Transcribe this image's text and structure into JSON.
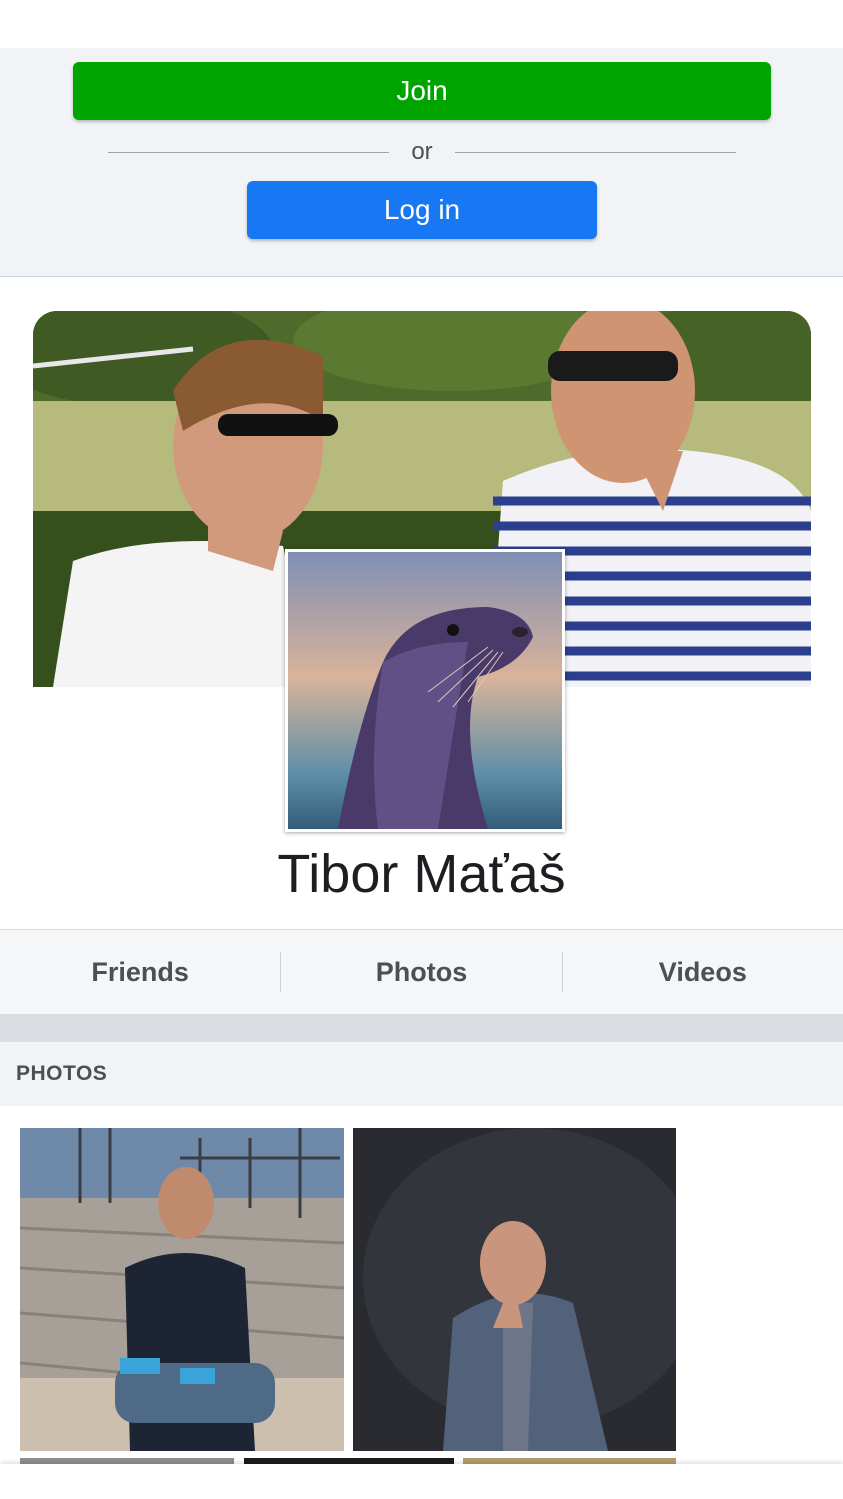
{
  "auth": {
    "join_label": "Join",
    "or_label": "or",
    "login_label": "Log in"
  },
  "profile": {
    "name": "Tibor Maťaš"
  },
  "tabs": [
    {
      "label": "Friends"
    },
    {
      "label": "Photos"
    },
    {
      "label": "Videos"
    }
  ],
  "photos_section": {
    "title": "PHOTOS"
  },
  "colors": {
    "join": "#00a400",
    "login": "#1877f2",
    "panel_bg": "#f1f3f6"
  }
}
